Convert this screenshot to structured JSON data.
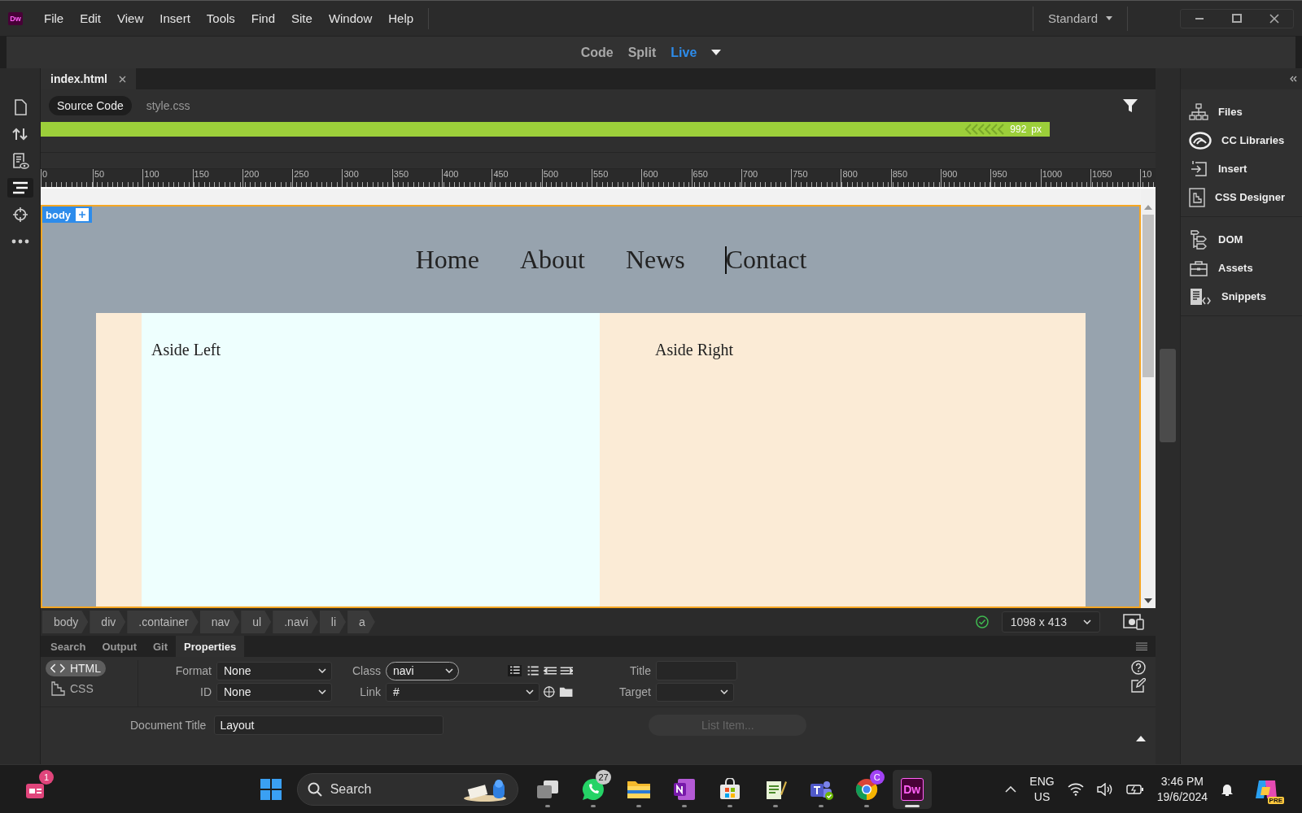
{
  "app": {
    "logo": "Dw"
  },
  "menu": [
    "File",
    "Edit",
    "View",
    "Insert",
    "Tools",
    "Find",
    "Site",
    "Window",
    "Help"
  ],
  "workspace": "Standard",
  "view_modes": [
    {
      "label": "Code",
      "selected": false
    },
    {
      "label": "Split",
      "selected": false
    },
    {
      "label": "Live",
      "selected": true
    }
  ],
  "left_toolbar": [
    {
      "kind": "file",
      "selected": false
    },
    {
      "kind": "transfer",
      "selected": false
    },
    {
      "kind": "preview",
      "selected": false
    },
    {
      "kind": "lines",
      "selected": true
    },
    {
      "kind": "target",
      "selected": false
    },
    {
      "kind": "more",
      "selected": false
    }
  ],
  "document_tabs": [
    {
      "label": "index.html",
      "selected": true
    }
  ],
  "related_files": [
    {
      "label": "Source Code",
      "selected": true
    },
    {
      "label": "style.css",
      "selected": false
    }
  ],
  "media_query": {
    "value": "992",
    "unit": "px"
  },
  "ruler": [
    "0",
    "50",
    "100",
    "150",
    "200",
    "250",
    "300",
    "350",
    "400",
    "450",
    "500",
    "550",
    "600",
    "650",
    "700",
    "750",
    "800",
    "850",
    "900",
    "950",
    "1000",
    "1050",
    "10"
  ],
  "live_view": {
    "body_tag": "body",
    "nav": [
      "Home",
      "About",
      "News",
      "Contact"
    ],
    "aside_left": "Aside Left",
    "aside_right": "Aside Right"
  },
  "tag_selector": [
    "body",
    "div",
    ".container",
    "nav",
    "ul",
    ".navi",
    "li",
    "a"
  ],
  "viewport_size": "1098 x 413",
  "panel_tabs": [
    {
      "label": "Search",
      "selected": false
    },
    {
      "label": "Output",
      "selected": false
    },
    {
      "label": "Git",
      "selected": false
    },
    {
      "label": "Properties",
      "selected": true
    }
  ],
  "properties": {
    "modes": [
      {
        "label": "HTML",
        "selected": true
      },
      {
        "label": "CSS",
        "selected": false
      }
    ],
    "format": {
      "label": "Format",
      "value": "None"
    },
    "id": {
      "label": "ID",
      "value": "None"
    },
    "class": {
      "label": "Class",
      "value": "navi"
    },
    "link": {
      "label": "Link",
      "value": "#"
    },
    "title": {
      "label": "Title"
    },
    "target": {
      "label": "Target"
    },
    "document_title": {
      "label": "Document Title",
      "value": "Layout"
    },
    "list_item": {
      "label": "List Item...",
      "disabled": true
    }
  },
  "right_panels": [
    {
      "items": [
        {
          "kind": "files",
          "label": "Files"
        },
        {
          "kind": "libraries",
          "label": "CC Libraries"
        },
        {
          "kind": "insert",
          "label": "Insert"
        },
        {
          "kind": "css",
          "label": "CSS Designer"
        }
      ]
    },
    {
      "items": [
        {
          "kind": "dom",
          "label": "DOM"
        },
        {
          "kind": "assets",
          "label": "Assets"
        },
        {
          "kind": "snippets",
          "label": "Snippets"
        }
      ]
    }
  ],
  "taskbar": {
    "search_placeholder": "Search",
    "apps": [
      {
        "kind": "taskview",
        "active": false
      },
      {
        "kind": "whatsapp",
        "badge": "27",
        "active": false
      },
      {
        "kind": "explorer",
        "active": false
      },
      {
        "kind": "onenote",
        "active": false
      },
      {
        "kind": "store",
        "active": false
      },
      {
        "kind": "notepad",
        "active": false
      },
      {
        "kind": "teams",
        "active": false
      },
      {
        "kind": "chrome",
        "badge": "C",
        "active": false
      },
      {
        "kind": "dw",
        "label": "Dw",
        "active": true
      }
    ],
    "widget_badge": "1",
    "language": "ENG",
    "region": "US",
    "time": "3:46 PM",
    "date": "19/6/2024",
    "copilot_tag": "PRE"
  }
}
